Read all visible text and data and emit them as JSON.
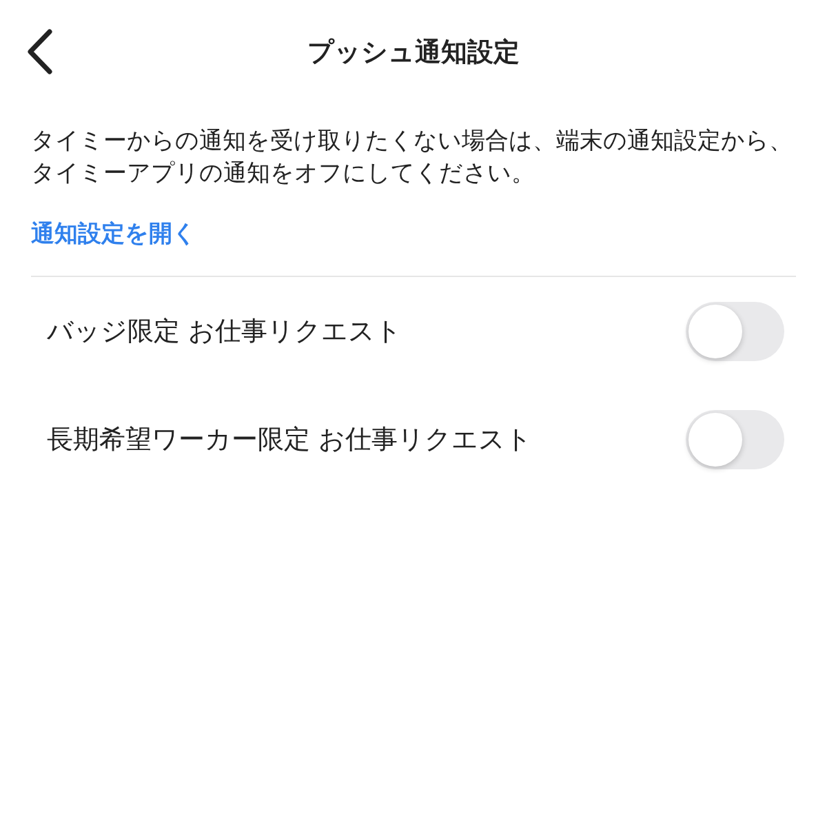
{
  "header": {
    "title": "プッシュ通知設定"
  },
  "description": "タイミーからの通知を受け取りたくない場合は、端末の通知設定から、タイミーアプリの通知をオフにしてください。",
  "link": "通知設定を開く",
  "settings": [
    {
      "label": "バッジ限定 お仕事リクエスト",
      "on": false
    },
    {
      "label": "長期希望ワーカー限定 お仕事リクエスト",
      "on": false
    }
  ]
}
